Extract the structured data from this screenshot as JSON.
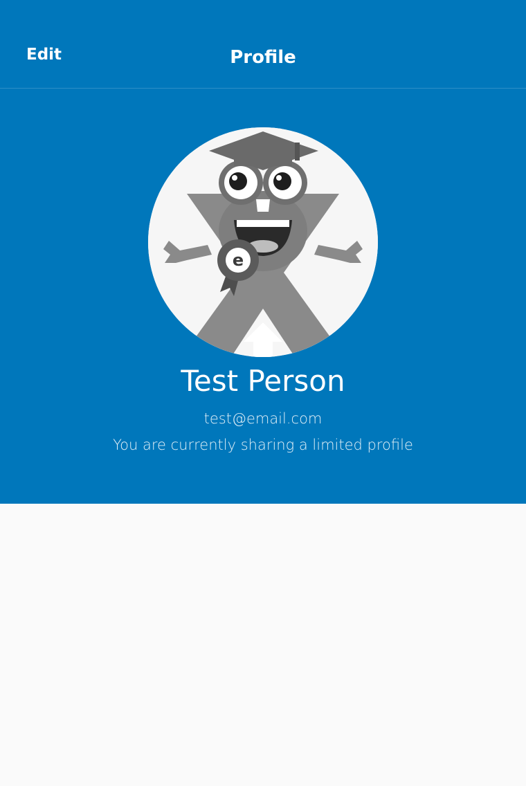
{
  "colors": {
    "brand": "#0077bb",
    "background": "#fafafa",
    "text_on_brand": "#ffffff"
  },
  "navbar": {
    "edit_label": "Edit",
    "title": "Profile"
  },
  "profile": {
    "avatar_icon": "mascot-graduate-x-icon",
    "avatar_badge_letter": "e",
    "name": "Test Person",
    "email": "test@email.com",
    "sharing_status": "You are currently sharing a limited profile"
  }
}
